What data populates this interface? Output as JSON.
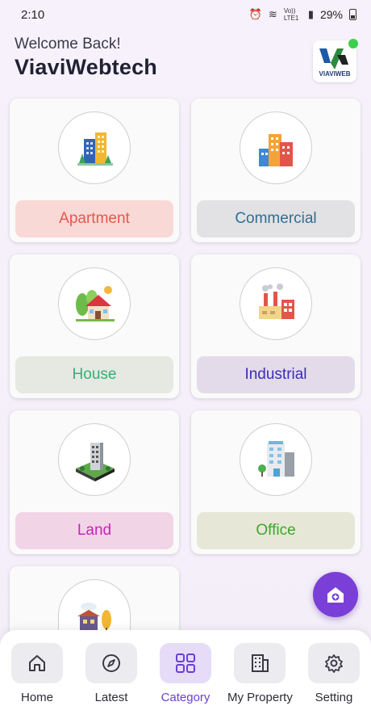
{
  "status_bar": {
    "time": "2:10",
    "network": "Vo)) LTE1",
    "battery": "29%"
  },
  "header": {
    "welcome": "Welcome Back!",
    "brand": "ViaviWebtech",
    "logo_text": "VIAVIWEB"
  },
  "categories": [
    {
      "label": "Apartment",
      "label_color": "#e2594c",
      "bg": "#f8d9d6",
      "icon": "apartment-building-icon"
    },
    {
      "label": "Commercial",
      "label_color": "#2f6f95",
      "bg": "#e2e1e4",
      "icon": "commercial-buildings-icon"
    },
    {
      "label": "House",
      "label_color": "#2fb277",
      "bg": "#e6e8e2",
      "icon": "house-icon"
    },
    {
      "label": "Industrial",
      "label_color": "#3a2fb3",
      "bg": "#e4dbea",
      "icon": "factory-icon"
    },
    {
      "label": "Land",
      "label_color": "#c626b4",
      "bg": "#f2d4e7",
      "icon": "land-plot-icon"
    },
    {
      "label": "Office",
      "label_color": "#3ea62c",
      "bg": "#e7e7d8",
      "icon": "office-building-icon"
    },
    {
      "label": "",
      "icon": "villa-icon"
    }
  ],
  "fab": {
    "icon": "add-home-icon"
  },
  "nav": [
    {
      "label": "Home",
      "icon": "home-icon"
    },
    {
      "label": "Latest",
      "icon": "compass-icon"
    },
    {
      "label": "Category",
      "icon": "grid-icon"
    },
    {
      "label": "My Property",
      "icon": "building-icon"
    },
    {
      "label": "Setting",
      "icon": "gear-icon"
    }
  ],
  "colors": {
    "accent": "#7a3fd6",
    "nav_active": "#6c3fd0"
  }
}
